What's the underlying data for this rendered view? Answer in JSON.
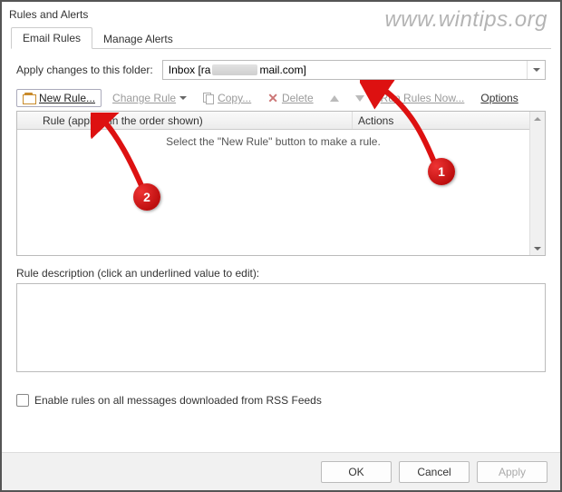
{
  "window": {
    "title": "Rules and Alerts"
  },
  "tabs": {
    "email_rules": "Email Rules",
    "manage_alerts": "Manage Alerts"
  },
  "folder": {
    "label": "Apply changes to this folder:",
    "value_prefix": "Inbox [ra",
    "value_suffix": "mail.com]"
  },
  "toolbar": {
    "new_rule": "New Rule...",
    "change_rule": "Change Rule",
    "copy": "Copy...",
    "delete": "Delete",
    "run_rules_now": "Run Rules Now...",
    "options": "Options"
  },
  "list": {
    "col_rule": "Rule (applied in the order shown)",
    "col_actions": "Actions",
    "empty_msg": "Select the \"New Rule\" button to make a rule."
  },
  "description": {
    "label": "Rule description (click an underlined value to edit):"
  },
  "rss": {
    "label": "Enable rules on all messages downloaded from RSS Feeds"
  },
  "buttons": {
    "ok": "OK",
    "cancel": "Cancel",
    "apply": "Apply"
  },
  "overlay": {
    "watermark": "www.wintips.org",
    "callout1": "1",
    "callout2": "2"
  }
}
